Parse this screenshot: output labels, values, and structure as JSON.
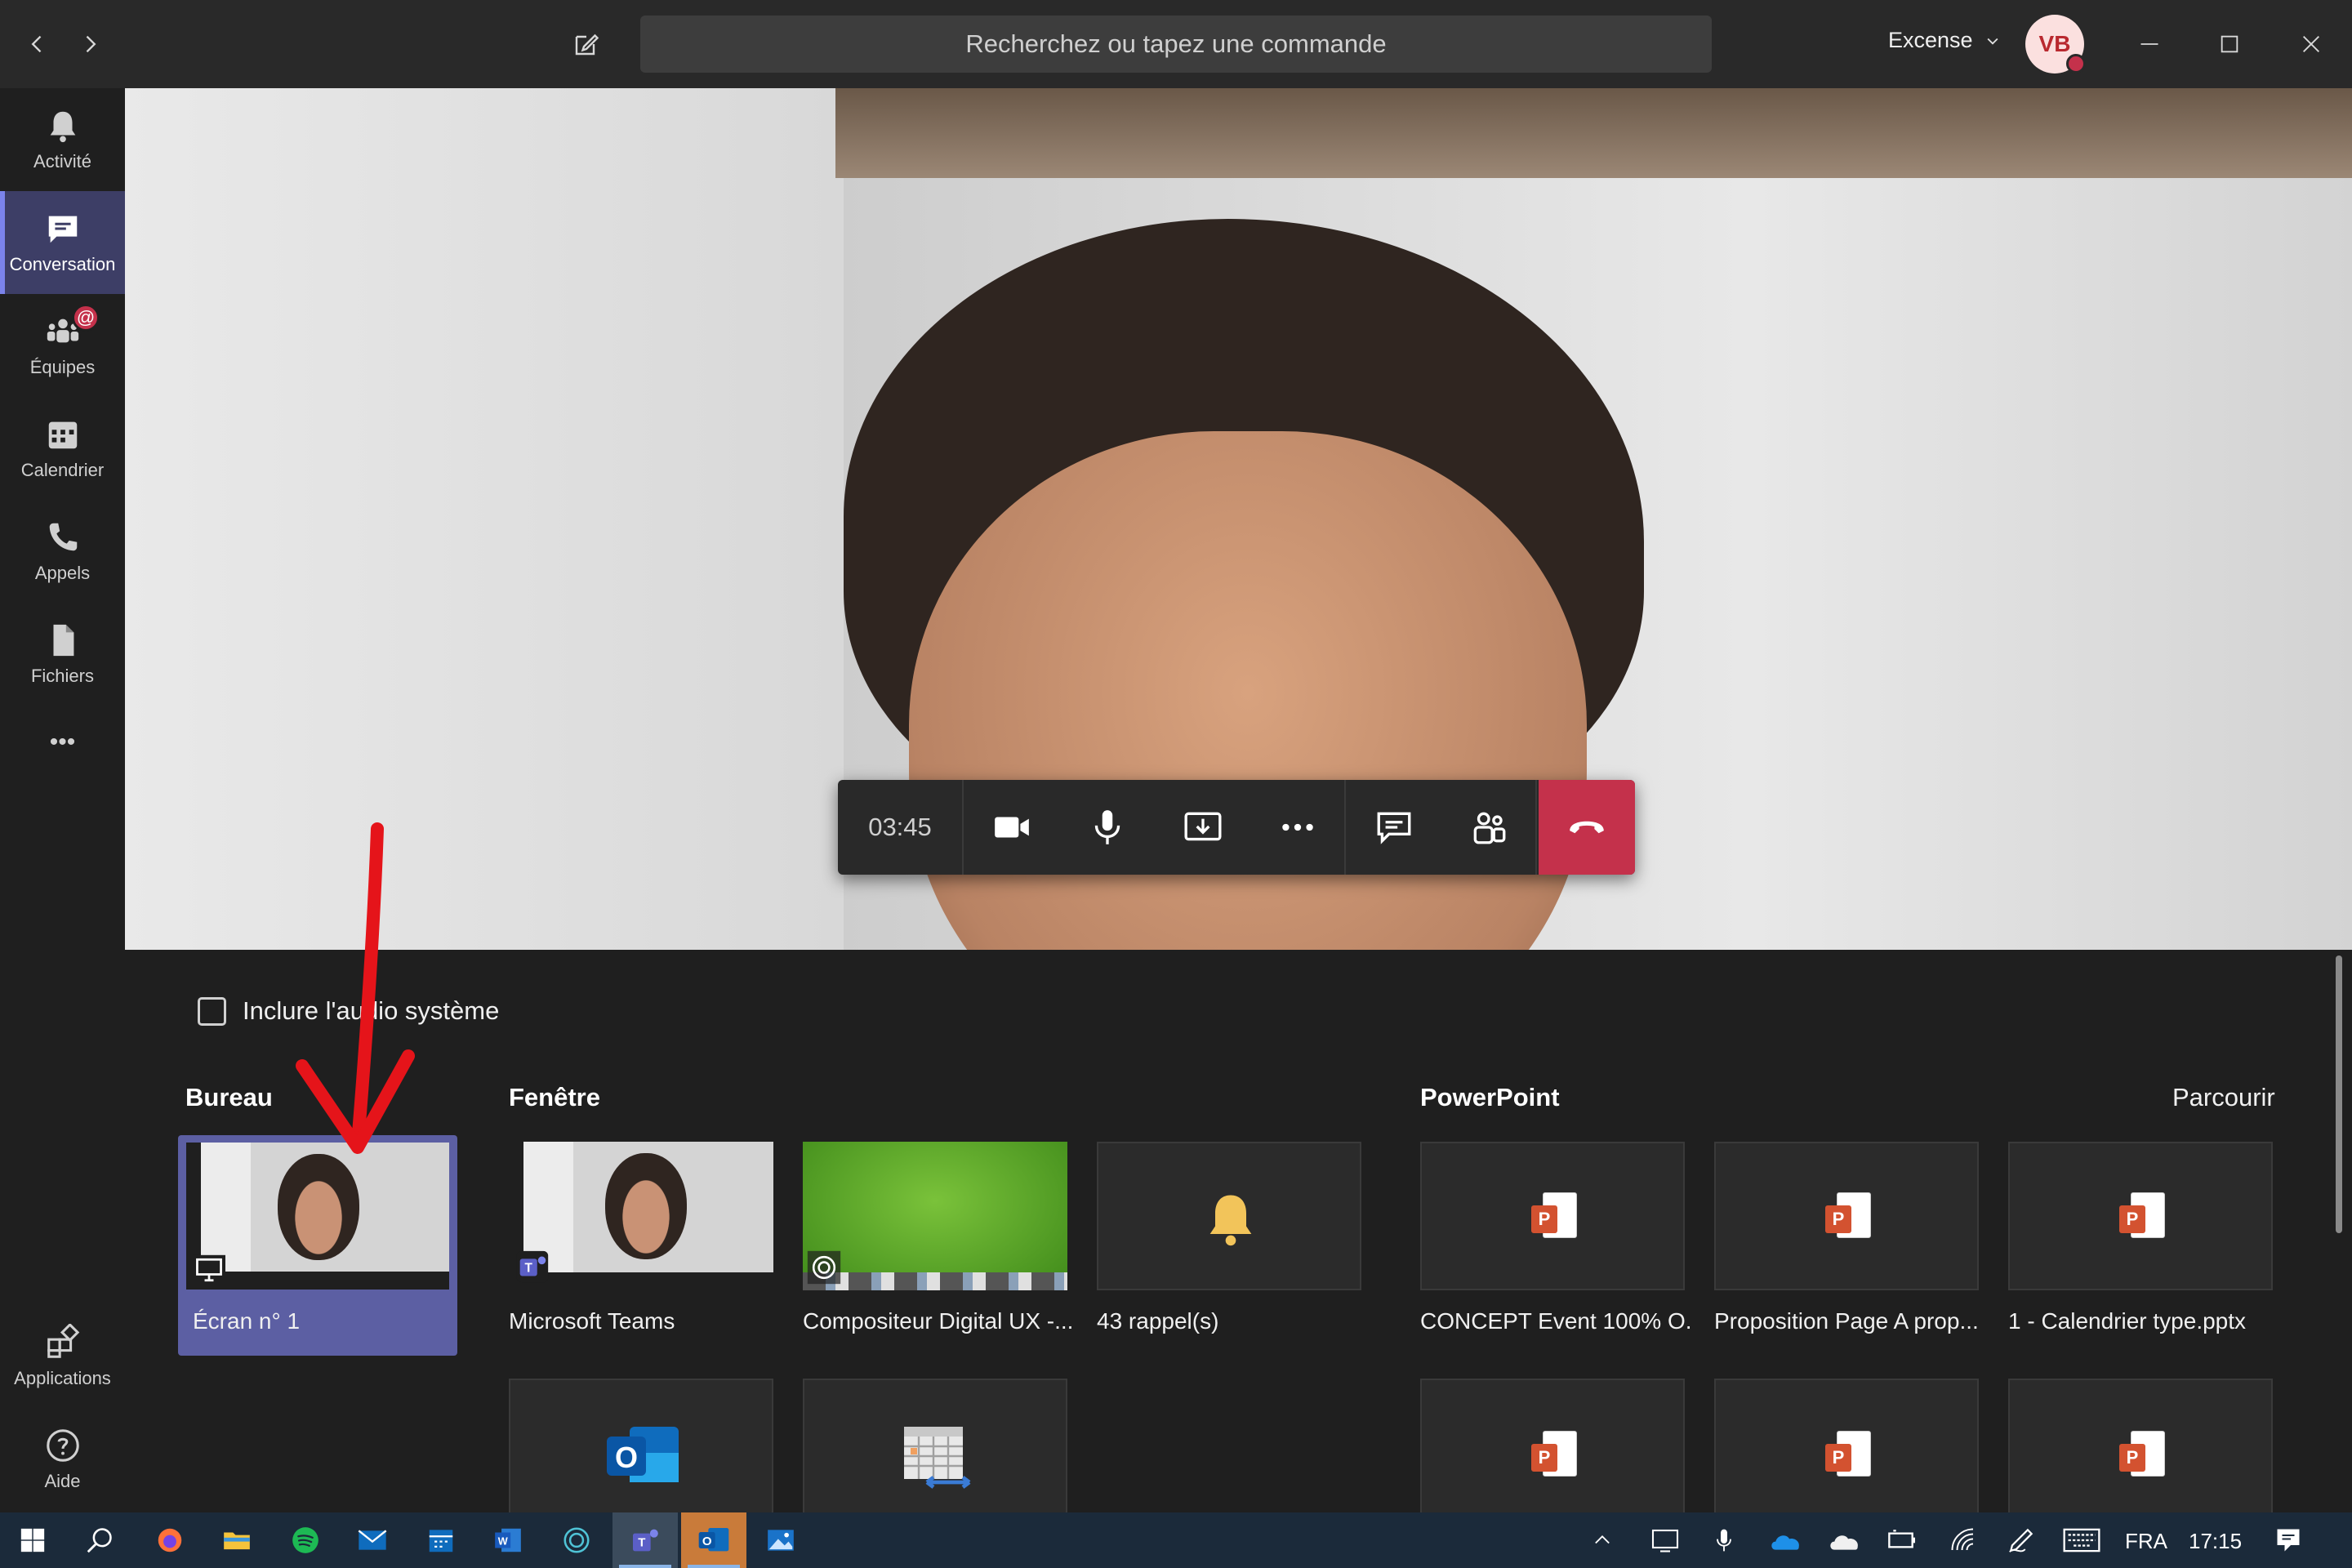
{
  "window": {
    "search_placeholder": "Recherchez ou tapez une commande",
    "org_name": "Excense",
    "avatar_initials": "VB"
  },
  "rail": {
    "items": [
      {
        "label": "Activité",
        "icon": "bell-icon"
      },
      {
        "label": "Conversation",
        "icon": "chat-icon",
        "active": true
      },
      {
        "label": "Équipes",
        "icon": "teams-icon",
        "badge": "@"
      },
      {
        "label": "Calendrier",
        "icon": "calendar-icon"
      },
      {
        "label": "Appels",
        "icon": "phone-icon"
      },
      {
        "label": "Fichiers",
        "icon": "file-icon"
      }
    ],
    "more": "•••",
    "applications": "Applications",
    "help": "Aide"
  },
  "call": {
    "timer": "03:45"
  },
  "share": {
    "include_audio": "Inclure l'audio système",
    "include_audio_checked": false,
    "sections": {
      "desktop": "Bureau",
      "window": "Fenêtre",
      "powerpoint": "PowerPoint",
      "browse": "Parcourir"
    },
    "desktop_tiles": [
      {
        "label": "Écran n° 1",
        "selected": true
      }
    ],
    "window_tiles": [
      {
        "label": "Microsoft Teams"
      },
      {
        "label": "Compositeur Digital UX -..."
      },
      {
        "label": "43 rappel(s)"
      }
    ],
    "powerpoint_tiles": [
      {
        "label": "CONCEPT Event 100% O..."
      },
      {
        "label": "Proposition Page A prop..."
      },
      {
        "label": "1 - Calendrier type.pptx"
      }
    ]
  },
  "taskbar": {
    "language": "FRA",
    "time": "17:15"
  },
  "colors": {
    "accent": "#7b83eb",
    "active_rail": "#3d3e66",
    "hangup": "#c4314b",
    "selected_tile": "#5c5fa3",
    "annotation_arrow": "#e5141a"
  }
}
